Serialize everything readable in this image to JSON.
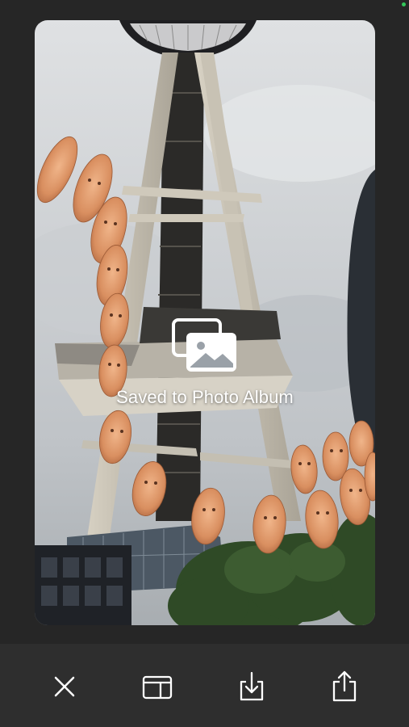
{
  "overlay": {
    "message": "Saved to Photo Album",
    "icon": "photo-album-icon"
  },
  "toolbar": {
    "buttons": [
      {
        "name": "close",
        "icon": "close-icon"
      },
      {
        "name": "layout",
        "icon": "layout-icon"
      },
      {
        "name": "download",
        "icon": "download-icon"
      },
      {
        "name": "share",
        "icon": "share-icon"
      }
    ]
  },
  "colors": {
    "background": "#262626",
    "toolbar": "#2e2e2e",
    "icon": "#ffffff",
    "status_dot": "#33c659"
  }
}
